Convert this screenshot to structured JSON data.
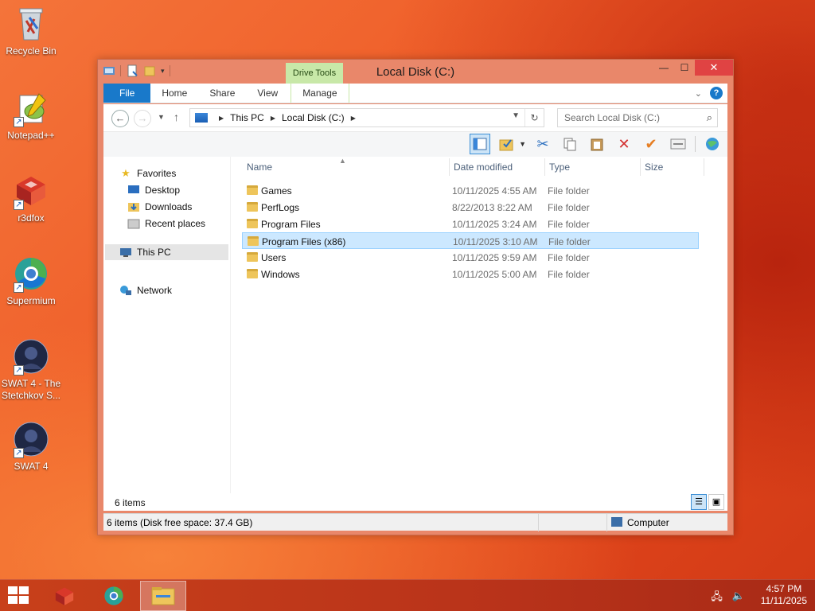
{
  "desktop": {
    "icons": [
      {
        "label": "Recycle Bin",
        "icon": "recycle-bin-icon"
      },
      {
        "label": "Notepad++",
        "icon": "notepad-plus-plus-icon"
      },
      {
        "label": "r3dfox",
        "icon": "r3dfox-icon"
      },
      {
        "label": "Supermium",
        "icon": "supermium-icon"
      },
      {
        "label": "SWAT 4 - The Stetchkov S...",
        "icon": "swat4-tsk-icon"
      },
      {
        "label": "SWAT 4",
        "icon": "swat4-icon"
      }
    ]
  },
  "window": {
    "title": "Local Disk (C:)",
    "contextual_tab_group": "Drive Tools",
    "ribbon_tabs": [
      "File",
      "Home",
      "Share",
      "View",
      "Manage"
    ],
    "address": {
      "crumbs": [
        "This PC",
        "Local Disk (C:)"
      ]
    },
    "search": {
      "placeholder": "Search Local Disk (C:)"
    },
    "nav": {
      "favorites": "Favorites",
      "desktop": "Desktop",
      "downloads": "Downloads",
      "recent": "Recent places",
      "thispc": "This PC",
      "network": "Network"
    },
    "columns": [
      "Name",
      "Date modified",
      "Type",
      "Size"
    ],
    "files": [
      {
        "name": "Games",
        "date": "10/11/2025 4:55 AM",
        "type": "File folder"
      },
      {
        "name": "PerfLogs",
        "date": "8/22/2013 8:22 AM",
        "type": "File folder"
      },
      {
        "name": "Program Files",
        "date": "10/11/2025 3:24 AM",
        "type": "File folder"
      },
      {
        "name": "Program Files (x86)",
        "date": "10/11/2025 3:10 AM",
        "type": "File folder"
      },
      {
        "name": "Users",
        "date": "10/11/2025 9:59 AM",
        "type": "File folder"
      },
      {
        "name": "Windows",
        "date": "10/11/2025 5:00 AM",
        "type": "File folder"
      }
    ],
    "selected_index": 3,
    "item_count": "6 items",
    "status_left": "6 items (Disk free space: 37.4 GB)",
    "status_right": "Computer"
  },
  "taskbar": {
    "time": "4:57 PM",
    "date": "11/11/2025"
  },
  "colors": {
    "accent": "#1979ca",
    "selection": "#cce8ff",
    "window_frame": "#e9876a",
    "drive_tools": "#c8e8a8"
  }
}
